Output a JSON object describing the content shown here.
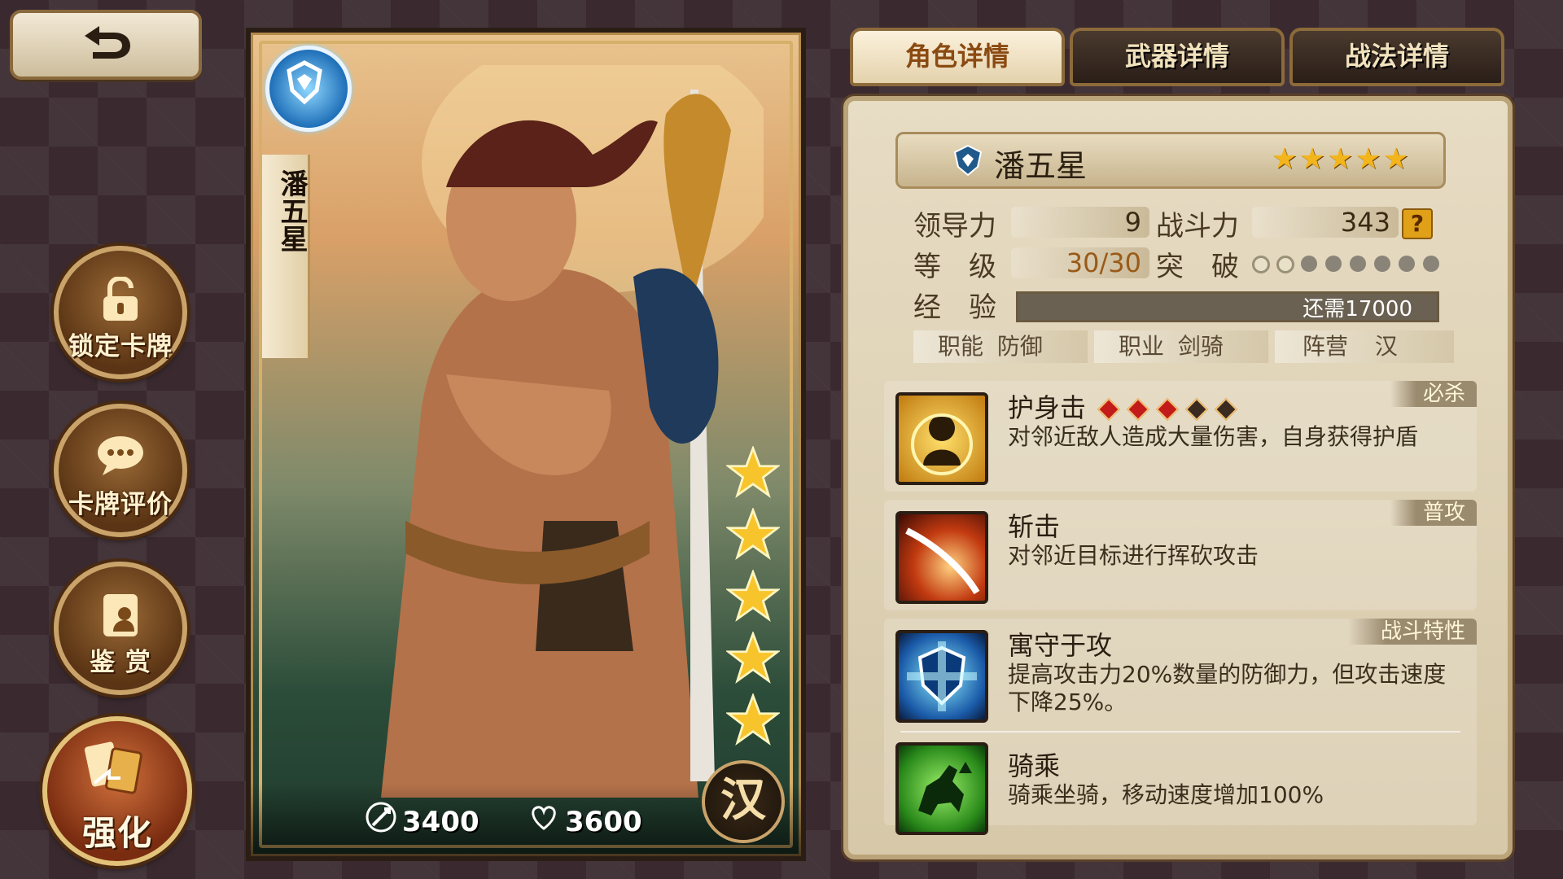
{
  "tabs": [
    {
      "label": "角色详情",
      "active": true
    },
    {
      "label": "武器详情",
      "active": false
    },
    {
      "label": "战法详情",
      "active": false
    }
  ],
  "side_buttons": {
    "lock": "锁定卡牌",
    "review": "卡牌评价",
    "appreciate": "鉴 赏",
    "enhance": "强化"
  },
  "card": {
    "name": "潘五星",
    "attack": "3400",
    "hp": "3600",
    "faction_glyph": "汉",
    "star_count": 5
  },
  "character": {
    "name": "潘五星",
    "stars": "★★★★★",
    "leadership_label": "领导力",
    "leadership": "9",
    "power_label": "战斗力",
    "power": "343",
    "level_label": "等　级",
    "level": "30/30",
    "breakthrough_label": "突　破",
    "breakthrough_filled": 2,
    "breakthrough_total": 8,
    "exp_label": "经　验",
    "exp_text": "还需17000",
    "role_label": "职能",
    "role": "防御",
    "class_label": "职业",
    "class": "剑骑",
    "camp_label": "阵营",
    "camp": "汉"
  },
  "skills": [
    {
      "name": "护身击",
      "type": "必杀",
      "desc": "对邻近敌人造成大量伤害，自身获得护盾",
      "level_filled": 3,
      "level_total": 5
    },
    {
      "name": "斩击",
      "type": "普攻",
      "desc": "对邻近目标进行挥砍攻击"
    },
    {
      "name": "寓守于攻",
      "type": "战斗特性",
      "desc": "提高攻击力20%数量的防御力，但攻击速度下降25%。"
    },
    {
      "name": "骑乘",
      "type": "",
      "desc": "骑乘坐骑，移动速度增加100%"
    }
  ],
  "help_glyph": "?",
  "colors": {
    "accent_gold": "#c9a36a",
    "star": "#f3b51c",
    "skill_diamond": "#c31a1a"
  }
}
